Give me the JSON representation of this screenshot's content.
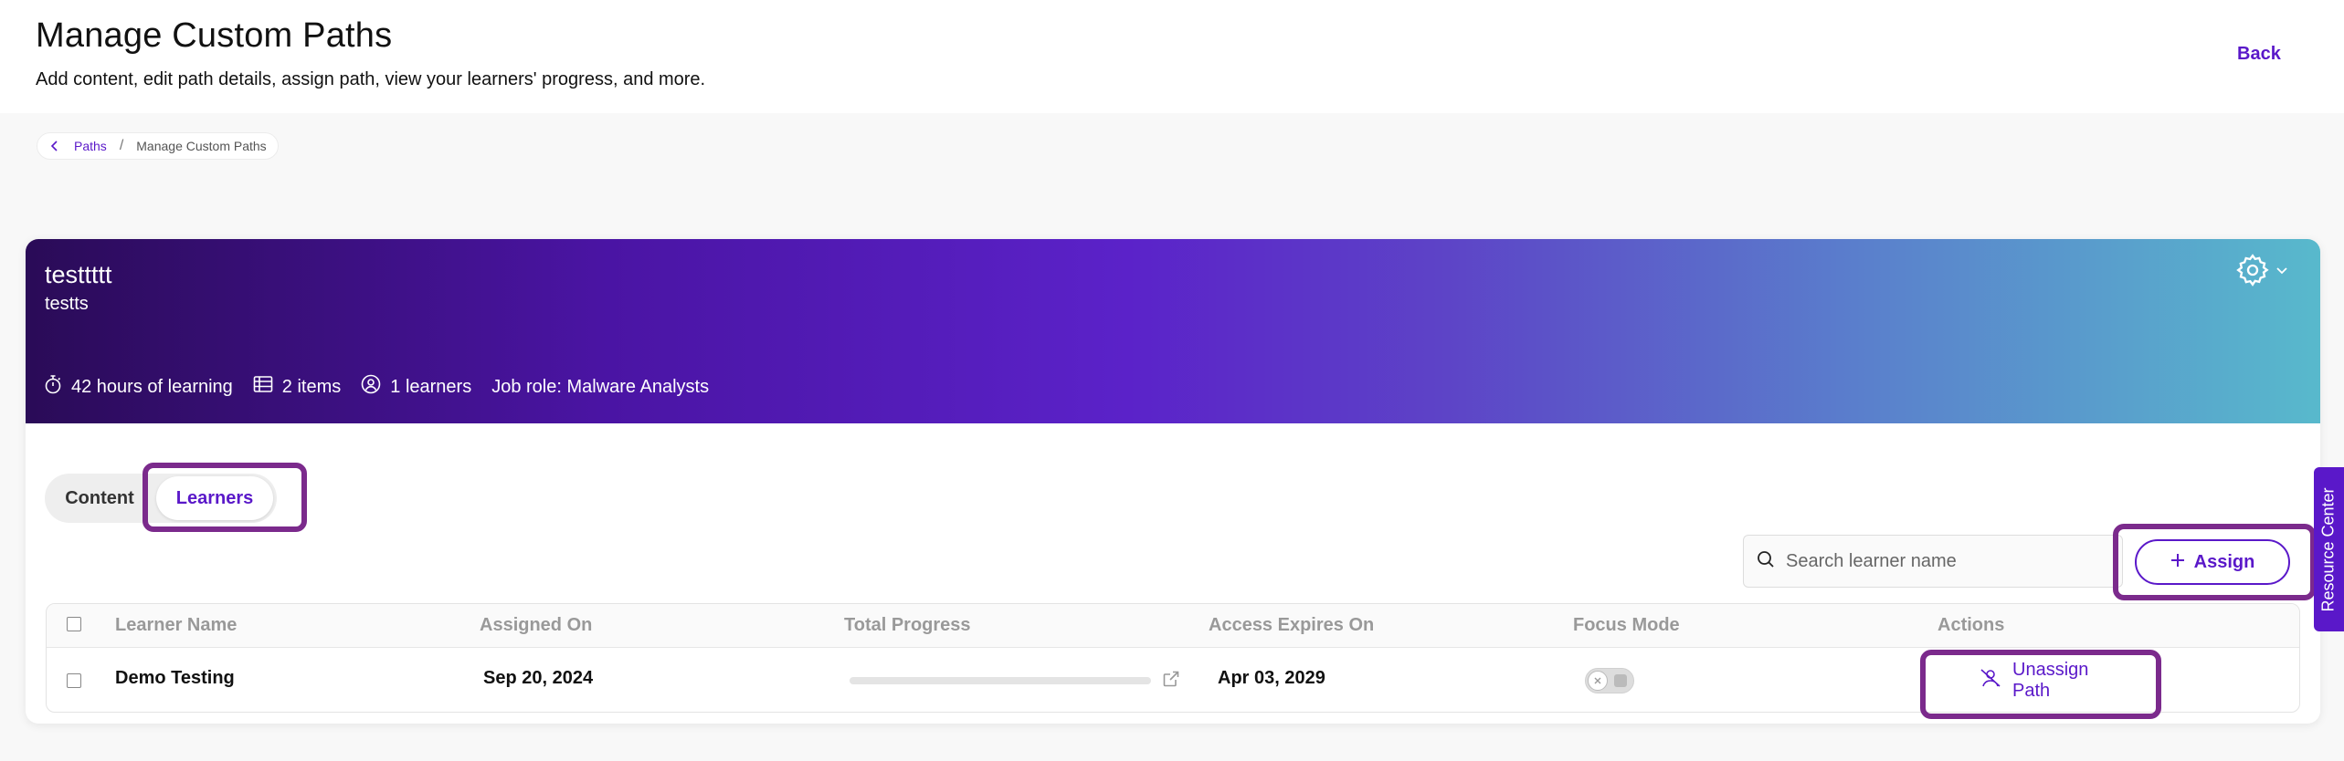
{
  "header": {
    "title": "Manage Custom Paths",
    "subtitle": "Add content, edit path details, assign path, view your learners' progress, and more.",
    "back_label": "Back"
  },
  "breadcrumb": {
    "link": "Paths",
    "separator": "/",
    "current": "Manage Custom Paths"
  },
  "path": {
    "name": "testtttt",
    "description": "testts",
    "settings_icon": "gear-icon",
    "meta": {
      "hours": "42 hours of learning",
      "items": "2 items",
      "learners": "1 learners",
      "job_role": "Job role: Malware Analysts"
    }
  },
  "tabs": {
    "content": "Content",
    "learners": "Learners",
    "active": "learners"
  },
  "search": {
    "placeholder": "Search learner name",
    "value": ""
  },
  "assign_label": "Assign",
  "table": {
    "columns": [
      "Learner Name",
      "Assigned On",
      "Total Progress",
      "Access Expires On",
      "Focus Mode",
      "Actions"
    ],
    "rows": [
      {
        "name": "Demo Testing",
        "assigned_on": "Sep 20, 2024",
        "progress": 0,
        "expires_on": "Apr 03, 2029",
        "focus_mode": false,
        "action": "Unassign Path"
      }
    ]
  },
  "resource_center": "Resource Center",
  "colors": {
    "accent": "#5a18c9",
    "highlight": "#7b2a8c",
    "banner_start": "#2a0b57",
    "banner_end": "#58b9cc"
  }
}
